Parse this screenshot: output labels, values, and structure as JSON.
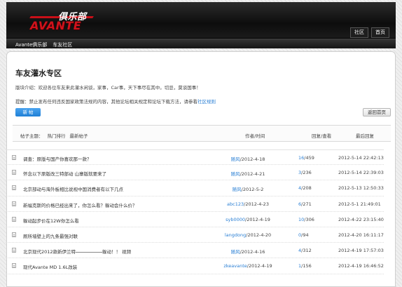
{
  "header": {
    "logo_chinese": "俱乐部",
    "logo_english": "AVANTE",
    "links": [
      "社区",
      "首页"
    ]
  },
  "breadcrumb": [
    "Avante俱乐部",
    "车友社区"
  ],
  "forum": {
    "title": "车友灌水专区",
    "intro": "版块介绍：欢迎各位车友来此灌水闲谈，家事，Car事，天下事尽在其中。切忌，莫谈国事！",
    "notice_text": "提醒：禁止发布任何违反国家政策法规的内容，其他论坛相关规定和论坛下载方法，请参看",
    "notice_link": "社区规则",
    "new_button": "新 帖",
    "back_button": "返回首页"
  },
  "table_header": {
    "topic_label": "帖子主题：",
    "filter_hot": "热门排行",
    "filter_newest": "最新帖子",
    "col_author": "作者/时间",
    "col_stats": "回复/查看",
    "col_last": "最后回复"
  },
  "rows": [
    {
      "title": "调查：原版与国产你喜欢那一款？",
      "author": "随风",
      "date": "/2012-4-18",
      "replies": "16",
      "views": "/459",
      "last": "2012-5-14 22:42:13"
    },
    {
      "title": "怀念以下原版改三特部动 山寨版就要来了",
      "author": "随风",
      "date": "/2012-4-21",
      "replies": "3",
      "views": "/236",
      "last": "2012-5-14 22:39:03"
    },
    {
      "title": "北京部动与海外板相比说视中国消费者有以下几点",
      "author": "随风",
      "date": "/2012-5-2",
      "replies": "4",
      "views": "/208",
      "last": "2012-5-13 12:50:33"
    },
    {
      "title": "新福克斯的价格已经出来了，你怎么看？躲动会什么价？",
      "author": "abc123",
      "date": "/2012-4-23",
      "replies": "6",
      "views": "/271",
      "last": "2012-5-1 21:49:01"
    },
    {
      "title": "躲动起步价在12W你怎么看",
      "author": "syb0000",
      "date": "/2012-4-19",
      "replies": "10",
      "views": "/306",
      "last": "2012-4-22 23:15:40"
    },
    {
      "title": "厕所墙壁上的九条最强对联",
      "author": "langdong",
      "date": "/2012-4-20",
      "replies": "0",
      "views": "/94",
      "last": "2012-4-20 16:11:17"
    },
    {
      "title_prefix": "北京现代2012款新伊兰特",
      "title": "躲动！！ 视频",
      "author": "随风",
      "date": "/2012-4-16",
      "replies": "4",
      "views": "/312",
      "last": "2012-4-19 17:57:03"
    },
    {
      "title": "现代Avante MD 1.6L改装",
      "author": "zkeavante",
      "date": "/2012-4-19",
      "replies": "1",
      "views": "/156",
      "last": "2012-4-19 16:46:52"
    }
  ]
}
